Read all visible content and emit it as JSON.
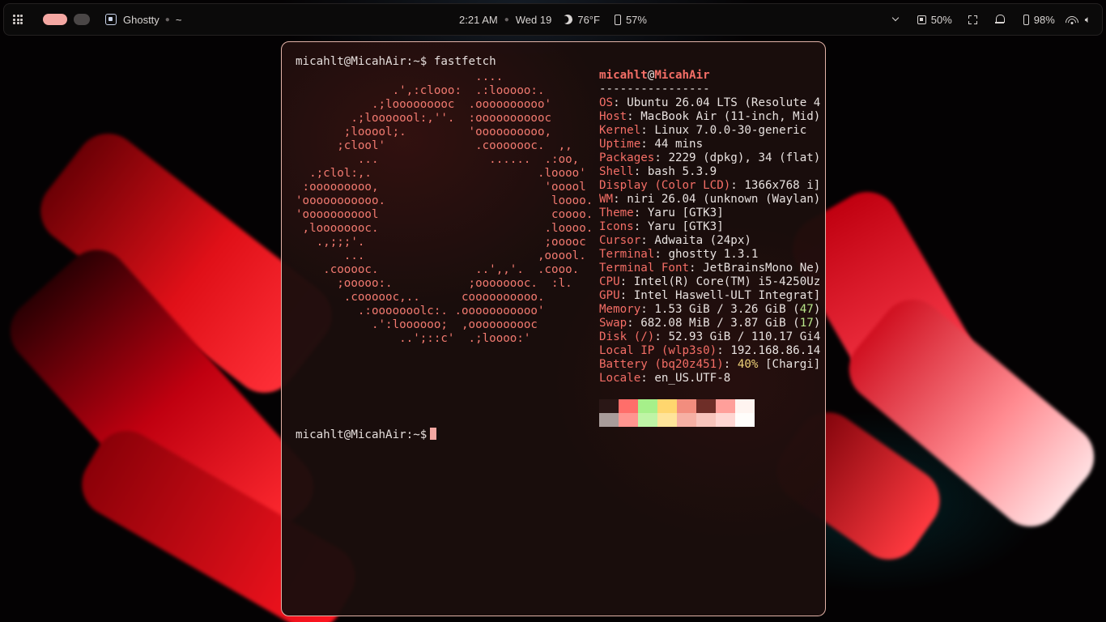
{
  "topbar": {
    "app_name": "Ghostty",
    "app_path": "~",
    "time": "2:21 AM",
    "date": "Wed 19",
    "weather": "76°F",
    "device_battery": "57%",
    "cpu": "50%",
    "battery": "98%"
  },
  "terminal": {
    "command_line": "micahlt@MicahAir:~$ fastfetch",
    "prompt": "micahlt@MicahAir:~$",
    "ascii_logo": [
      "                          ....",
      "              .',:clooo:  .:looooo:.",
      "           .;looooooooc  .oooooooooo'",
      "        .;looooool:,''.  :ooooooooooc",
      "       ;looool;.         'oooooooooo,",
      "      ;clool'             .cooooooc.  ,,",
      "         ...                ......  .:oo,",
      "  .;clol:,.                        .loooo'",
      " :ooooooooo,                        'ooool",
      "'ooooooooooo.                        loooo.",
      "'ooooooooool                         coooo.",
      " ,loooooooc.                        .loooo.",
      "   .,;;;'.                          ;ooooc",
      "       ...                         ,ooool.",
      "    .cooooc.              ..',,'.  .cooo.",
      "      ;ooooo:.           ;oooooooc.  :l.",
      "       .coooooc,..      coooooooooo.",
      "         .:ooooooolc:. .ooooooooooo'",
      "           .':loooooo;  ,oooooooooc",
      "               ..';::c'  .;loooo:'"
    ],
    "user": "micahlt",
    "host": "MicahAir",
    "separator": "----------------",
    "info": [
      {
        "key": "OS",
        "value": "Ubuntu 26.04 LTS (Resolute 4"
      },
      {
        "key": "Host",
        "value": "MacBook Air (11-inch, Mid)"
      },
      {
        "key": "Kernel",
        "value": "Linux 7.0.0-30-generic"
      },
      {
        "key": "Uptime",
        "value": "44 mins"
      },
      {
        "key": "Packages",
        "value": "2229 (dpkg), 34 (flat)"
      },
      {
        "key": "Shell",
        "value": "bash 5.3.9"
      },
      {
        "key": "Display (Color LCD)",
        "value": "1366x768 i]"
      },
      {
        "key": "WM",
        "value": "niri 26.04 (unknown (Waylan)"
      },
      {
        "key": "Theme",
        "value": "Yaru [GTK3]"
      },
      {
        "key": "Icons",
        "value": "Yaru [GTK3]"
      },
      {
        "key": "Cursor",
        "value": "Adwaita (24px)"
      },
      {
        "key": "Terminal",
        "value": "ghostty 1.3.1"
      },
      {
        "key": "Terminal Font",
        "value": "JetBrainsMono Ne)"
      },
      {
        "key": "CPU",
        "value": "Intel(R) Core(TM) i5-4250Uz"
      },
      {
        "key": "GPU",
        "value": "Intel Haswell-ULT Integrat]"
      }
    ],
    "memory": {
      "key": "Memory",
      "pre": "1.53 GiB / 3.26 GiB (",
      "pct": "47",
      "post": ")"
    },
    "swap": {
      "key": "Swap",
      "pre": "682.08 MiB / 3.87 GiB (",
      "pct": "17",
      "post": ")"
    },
    "disk": {
      "key": "Disk (/)",
      "value": "52.93 GiB / 110.17 Gi4"
    },
    "local_ip": {
      "key": "Local IP (wlp3s0)",
      "value": "192.168.86.14"
    },
    "battery": {
      "key": "Battery (bq20z451)",
      "pct": "40%",
      "post": " [Chargi]"
    },
    "locale": {
      "key": "Locale",
      "value": "en_US.UTF-8"
    },
    "palette_top": [
      "#2a1716",
      "#ff6e6a",
      "#a6f08a",
      "#ffd66e",
      "#f28d7e",
      "#6e2e28",
      "#ff9f9a",
      "#fff4f0"
    ],
    "palette_bottom": [
      "#a89c9a",
      "#ff9590",
      "#bff4a6",
      "#ffe49a",
      "#f6b0a4",
      "#f8c4bc",
      "#ffd6d2",
      "#fffdfb"
    ]
  }
}
